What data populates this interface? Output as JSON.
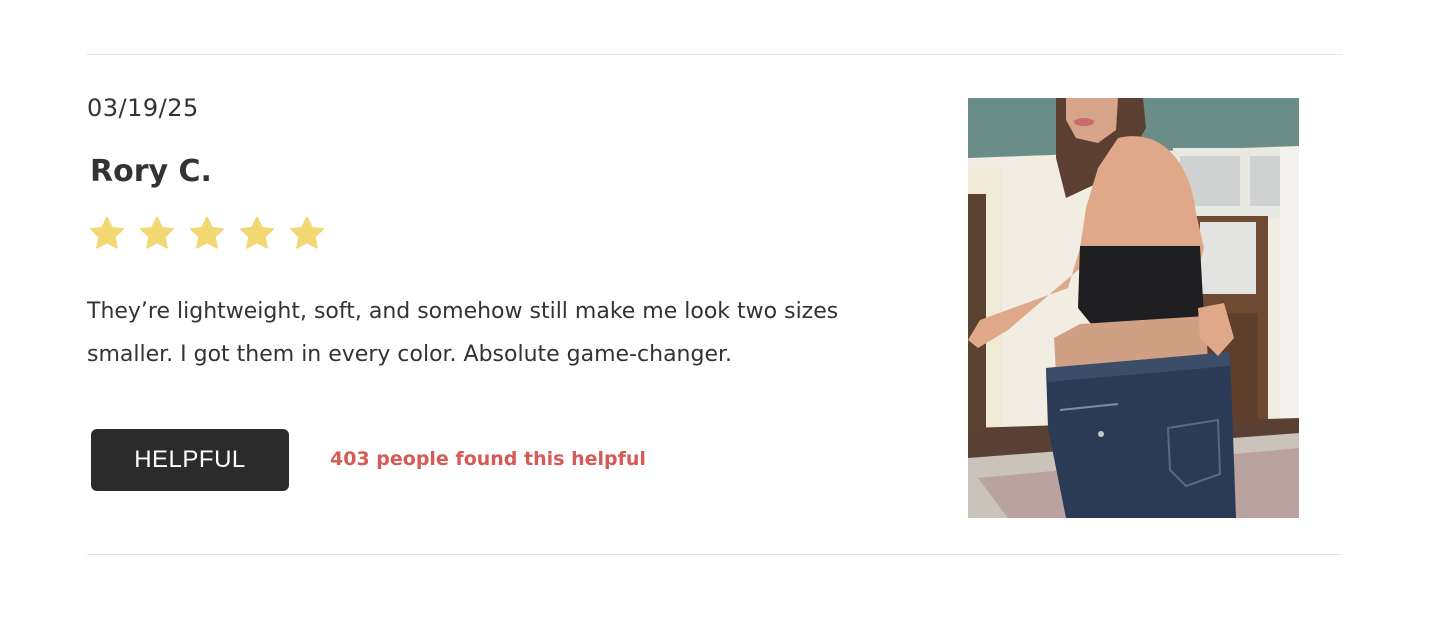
{
  "review": {
    "date": "03/19/25",
    "reviewer": "Rory C.",
    "rating": 5,
    "rating_max": 5,
    "body": "They’re lightweight, soft, and somehow still make me look two sizes smaller. I got them in every color. Absolute game-changer.",
    "helpful_button_label": "HELPFUL",
    "helpful_count_text": "403 people found this helpful",
    "photo": "review-photo"
  },
  "colors": {
    "star": "#f2d872",
    "button_bg": "#2b2b2b",
    "helpful_count": "#d65a55",
    "text": "#333333",
    "divider": "#e4e4e4"
  },
  "icons": [
    "star-icon"
  ]
}
